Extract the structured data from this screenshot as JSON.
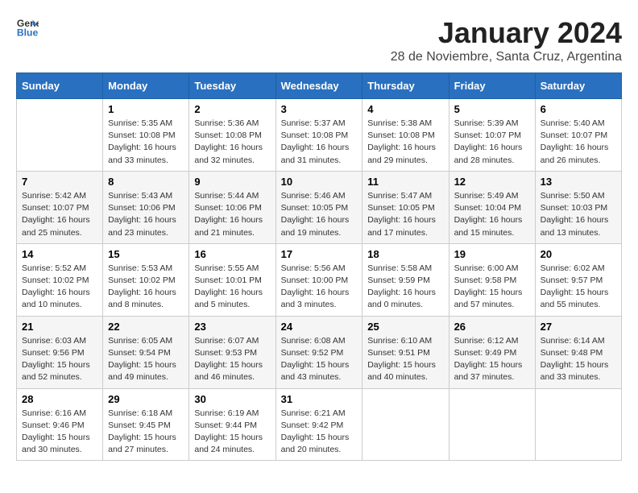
{
  "logo": {
    "line1": "General",
    "line2": "Blue"
  },
  "title": "January 2024",
  "subtitle": "28 de Noviembre, Santa Cruz, Argentina",
  "weekdays": [
    "Sunday",
    "Monday",
    "Tuesday",
    "Wednesday",
    "Thursday",
    "Friday",
    "Saturday"
  ],
  "weeks": [
    [
      {
        "day": "",
        "info": ""
      },
      {
        "day": "1",
        "info": "Sunrise: 5:35 AM\nSunset: 10:08 PM\nDaylight: 16 hours\nand 33 minutes."
      },
      {
        "day": "2",
        "info": "Sunrise: 5:36 AM\nSunset: 10:08 PM\nDaylight: 16 hours\nand 32 minutes."
      },
      {
        "day": "3",
        "info": "Sunrise: 5:37 AM\nSunset: 10:08 PM\nDaylight: 16 hours\nand 31 minutes."
      },
      {
        "day": "4",
        "info": "Sunrise: 5:38 AM\nSunset: 10:08 PM\nDaylight: 16 hours\nand 29 minutes."
      },
      {
        "day": "5",
        "info": "Sunrise: 5:39 AM\nSunset: 10:07 PM\nDaylight: 16 hours\nand 28 minutes."
      },
      {
        "day": "6",
        "info": "Sunrise: 5:40 AM\nSunset: 10:07 PM\nDaylight: 16 hours\nand 26 minutes."
      }
    ],
    [
      {
        "day": "7",
        "info": "Sunrise: 5:42 AM\nSunset: 10:07 PM\nDaylight: 16 hours\nand 25 minutes."
      },
      {
        "day": "8",
        "info": "Sunrise: 5:43 AM\nSunset: 10:06 PM\nDaylight: 16 hours\nand 23 minutes."
      },
      {
        "day": "9",
        "info": "Sunrise: 5:44 AM\nSunset: 10:06 PM\nDaylight: 16 hours\nand 21 minutes."
      },
      {
        "day": "10",
        "info": "Sunrise: 5:46 AM\nSunset: 10:05 PM\nDaylight: 16 hours\nand 19 minutes."
      },
      {
        "day": "11",
        "info": "Sunrise: 5:47 AM\nSunset: 10:05 PM\nDaylight: 16 hours\nand 17 minutes."
      },
      {
        "day": "12",
        "info": "Sunrise: 5:49 AM\nSunset: 10:04 PM\nDaylight: 16 hours\nand 15 minutes."
      },
      {
        "day": "13",
        "info": "Sunrise: 5:50 AM\nSunset: 10:03 PM\nDaylight: 16 hours\nand 13 minutes."
      }
    ],
    [
      {
        "day": "14",
        "info": "Sunrise: 5:52 AM\nSunset: 10:02 PM\nDaylight: 16 hours\nand 10 minutes."
      },
      {
        "day": "15",
        "info": "Sunrise: 5:53 AM\nSunset: 10:02 PM\nDaylight: 16 hours\nand 8 minutes."
      },
      {
        "day": "16",
        "info": "Sunrise: 5:55 AM\nSunset: 10:01 PM\nDaylight: 16 hours\nand 5 minutes."
      },
      {
        "day": "17",
        "info": "Sunrise: 5:56 AM\nSunset: 10:00 PM\nDaylight: 16 hours\nand 3 minutes."
      },
      {
        "day": "18",
        "info": "Sunrise: 5:58 AM\nSunset: 9:59 PM\nDaylight: 16 hours\nand 0 minutes."
      },
      {
        "day": "19",
        "info": "Sunrise: 6:00 AM\nSunset: 9:58 PM\nDaylight: 15 hours\nand 57 minutes."
      },
      {
        "day": "20",
        "info": "Sunrise: 6:02 AM\nSunset: 9:57 PM\nDaylight: 15 hours\nand 55 minutes."
      }
    ],
    [
      {
        "day": "21",
        "info": "Sunrise: 6:03 AM\nSunset: 9:56 PM\nDaylight: 15 hours\nand 52 minutes."
      },
      {
        "day": "22",
        "info": "Sunrise: 6:05 AM\nSunset: 9:54 PM\nDaylight: 15 hours\nand 49 minutes."
      },
      {
        "day": "23",
        "info": "Sunrise: 6:07 AM\nSunset: 9:53 PM\nDaylight: 15 hours\nand 46 minutes."
      },
      {
        "day": "24",
        "info": "Sunrise: 6:08 AM\nSunset: 9:52 PM\nDaylight: 15 hours\nand 43 minutes."
      },
      {
        "day": "25",
        "info": "Sunrise: 6:10 AM\nSunset: 9:51 PM\nDaylight: 15 hours\nand 40 minutes."
      },
      {
        "day": "26",
        "info": "Sunrise: 6:12 AM\nSunset: 9:49 PM\nDaylight: 15 hours\nand 37 minutes."
      },
      {
        "day": "27",
        "info": "Sunrise: 6:14 AM\nSunset: 9:48 PM\nDaylight: 15 hours\nand 33 minutes."
      }
    ],
    [
      {
        "day": "28",
        "info": "Sunrise: 6:16 AM\nSunset: 9:46 PM\nDaylight: 15 hours\nand 30 minutes."
      },
      {
        "day": "29",
        "info": "Sunrise: 6:18 AM\nSunset: 9:45 PM\nDaylight: 15 hours\nand 27 minutes."
      },
      {
        "day": "30",
        "info": "Sunrise: 6:19 AM\nSunset: 9:44 PM\nDaylight: 15 hours\nand 24 minutes."
      },
      {
        "day": "31",
        "info": "Sunrise: 6:21 AM\nSunset: 9:42 PM\nDaylight: 15 hours\nand 20 minutes."
      },
      {
        "day": "",
        "info": ""
      },
      {
        "day": "",
        "info": ""
      },
      {
        "day": "",
        "info": ""
      }
    ]
  ]
}
